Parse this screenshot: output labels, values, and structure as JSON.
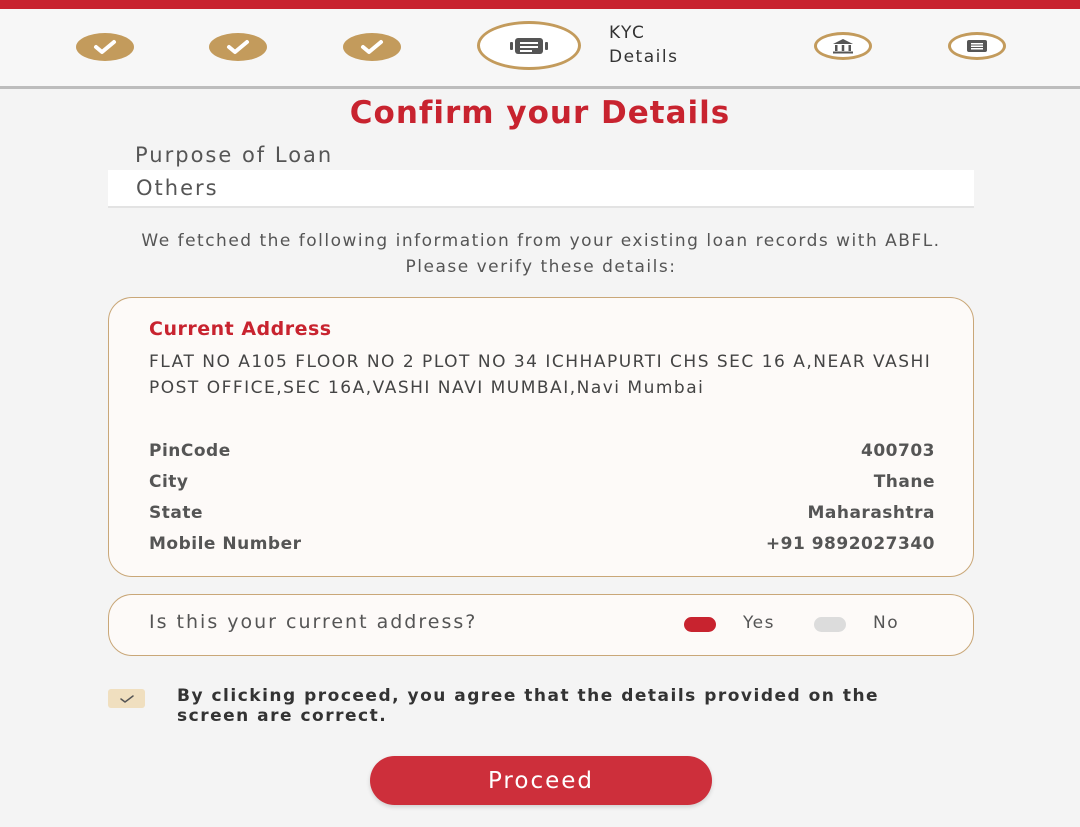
{
  "stepper": {
    "current_label": "KYC\nDetails"
  },
  "page": {
    "title": "Confirm your Details"
  },
  "loan_purpose": {
    "label": "Purpose of Loan",
    "value": "Others"
  },
  "info_text": "We fetched the following information from your existing loan records with ABFL. Please verify these details:",
  "address_card": {
    "title": "Current Address",
    "address": "FLAT NO A105 FLOOR NO 2 PLOT NO 34 ICHHAPURTI CHS SEC 16 A,NEAR VASHI POST OFFICE,SEC 16A,VASHI NAVI MUMBAI,Navi Mumbai",
    "rows": [
      {
        "label": "PinCode",
        "value": "400703"
      },
      {
        "label": "City",
        "value": "Thane"
      },
      {
        "label": "State",
        "value": "Maharashtra"
      },
      {
        "label": "Mobile Number",
        "value": "+91 9892027340"
      }
    ]
  },
  "address_question": {
    "text": "Is this your current address?",
    "yes_label": "Yes",
    "no_label": "No",
    "selected": "Yes"
  },
  "agreement": {
    "text": "By clicking proceed, you agree that the details provided on the screen are correct.",
    "checked": true
  },
  "proceed_label": "Proceed",
  "colors": {
    "brand_red": "#c8232f",
    "gold": "#c39b5c"
  },
  "icons": [
    "check-icon",
    "document-icon",
    "bank-icon",
    "list-icon"
  ]
}
